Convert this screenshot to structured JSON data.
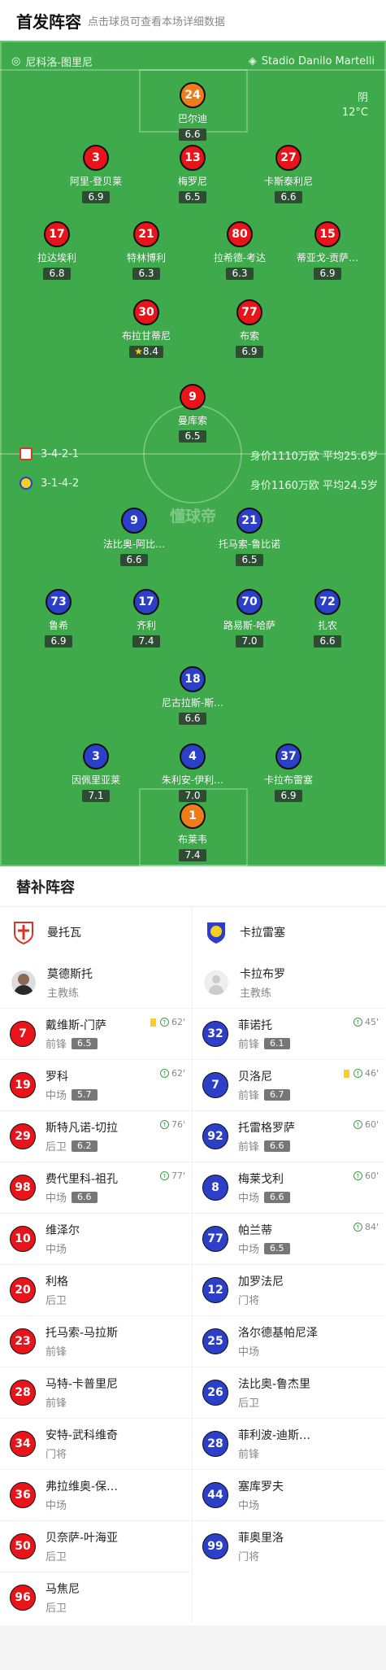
{
  "header": {
    "title": "首发阵容",
    "subtitle": "点击球员可查看本场详细数据"
  },
  "pitch": {
    "home_team": "尼科洛-图里尼",
    "stadium": "Stadio Danilo Martelli",
    "weather": "阴",
    "temperature": "12°C",
    "watermark": "懂球帝",
    "home_formation": "3-4-2-1",
    "home_value": "身价1110万欧 平均25.6岁",
    "away_formation": "3-1-4-2",
    "away_value": "身价1160万欧 平均24.5岁"
  },
  "home_players": [
    {
      "num": "24",
      "name": "巴尔迪",
      "rating": "6.6",
      "color": "orange"
    },
    {
      "num": "3",
      "name": "阿里-登贝莱",
      "rating": "6.9",
      "color": "red"
    },
    {
      "num": "13",
      "name": "梅罗尼",
      "rating": "6.5",
      "color": "red",
      "yellow": true
    },
    {
      "num": "27",
      "name": "卡斯泰利尼",
      "rating": "6.6",
      "color": "red"
    },
    {
      "num": "17",
      "name": "拉达埃利",
      "rating": "6.8",
      "color": "red",
      "sub": "76'"
    },
    {
      "num": "21",
      "name": "特林博利",
      "rating": "6.3",
      "color": "red"
    },
    {
      "num": "80",
      "name": "拉希德-考达",
      "rating": "6.3",
      "color": "red",
      "yellow": true
    },
    {
      "num": "15",
      "name": "蒂亚戈-贡萨…",
      "rating": "6.9",
      "color": "red"
    },
    {
      "num": "30",
      "name": "布拉甘蒂尼",
      "rating": "8.4",
      "color": "red",
      "sub": "62'",
      "goal": true,
      "star": true
    },
    {
      "num": "77",
      "name": "布索",
      "rating": "6.9",
      "color": "red",
      "sub": "77'"
    },
    {
      "num": "9",
      "name": "曼库索",
      "rating": "6.5",
      "color": "red",
      "sub": "62'",
      "captain": true
    }
  ],
  "away_players": [
    {
      "num": "9",
      "name": "法比奥-阿比…",
      "rating": "6.6",
      "color": "blue",
      "sub": "60'"
    },
    {
      "num": "21",
      "name": "托马索-鲁比诺",
      "rating": "6.5",
      "color": "blue",
      "sub": "60'"
    },
    {
      "num": "73",
      "name": "鲁希",
      "rating": "6.9",
      "color": "blue",
      "sub": "46'"
    },
    {
      "num": "17",
      "name": "齐利",
      "rating": "7.4",
      "color": "blue"
    },
    {
      "num": "70",
      "name": "路易斯-哈萨",
      "rating": "7.0",
      "color": "blue",
      "sub": "84'",
      "yellow": true,
      "goal": true
    },
    {
      "num": "72",
      "name": "扎农",
      "rating": "6.6",
      "color": "blue",
      "yellow": true,
      "goal": true
    },
    {
      "num": "18",
      "name": "尼古拉斯-斯…",
      "rating": "6.6",
      "color": "blue",
      "sub": "45'"
    },
    {
      "num": "3",
      "name": "因佩里亚莱",
      "rating": "7.1",
      "color": "blue",
      "captain": true
    },
    {
      "num": "4",
      "name": "朱利安-伊利…",
      "rating": "7.0",
      "color": "blue",
      "yellow": true
    },
    {
      "num": "37",
      "name": "卡拉布雷塞",
      "rating": "6.9",
      "color": "blue"
    },
    {
      "num": "1",
      "name": "布莱韦",
      "rating": "7.4",
      "color": "orange"
    }
  ],
  "bench": {
    "title": "替补阵容",
    "home": {
      "team": "曼托瓦",
      "coach": "莫德斯托",
      "coach_role": "主教练",
      "players": [
        {
          "num": "7",
          "name": "戴维斯-门萨",
          "pos": "前锋",
          "rating": "6.5",
          "sub": "62'",
          "yellow": true
        },
        {
          "num": "19",
          "name": "罗科",
          "pos": "中场",
          "rating": "5.7",
          "sub": "62'"
        },
        {
          "num": "29",
          "name": "斯特凡诺-切拉",
          "pos": "后卫",
          "rating": "6.2",
          "sub": "76'"
        },
        {
          "num": "98",
          "name": "费代里科-祖孔",
          "pos": "中场",
          "rating": "6.6",
          "sub": "77'"
        },
        {
          "num": "10",
          "name": "维泽尔",
          "pos": "中场"
        },
        {
          "num": "20",
          "name": "利格",
          "pos": "后卫"
        },
        {
          "num": "23",
          "name": "托马索-马拉斯",
          "pos": "前锋"
        },
        {
          "num": "28",
          "name": "马特-卡普里尼",
          "pos": "前锋"
        },
        {
          "num": "34",
          "name": "安特-武科维奇",
          "pos": "门将"
        },
        {
          "num": "36",
          "name": "弗拉维奥-保…",
          "pos": "中场"
        },
        {
          "num": "50",
          "name": "贝奈萨-叶海亚",
          "pos": "后卫"
        },
        {
          "num": "96",
          "name": "马焦尼",
          "pos": "后卫"
        }
      ]
    },
    "away": {
      "team": "卡拉雷塞",
      "coach": "卡拉布罗",
      "coach_role": "主教练",
      "players": [
        {
          "num": "32",
          "name": "菲诺托",
          "pos": "前锋",
          "rating": "6.1",
          "sub": "45'"
        },
        {
          "num": "7",
          "name": "贝洛尼",
          "pos": "前锋",
          "rating": "6.7",
          "sub": "46'",
          "yellow": true
        },
        {
          "num": "92",
          "name": "托雷格罗萨",
          "pos": "前锋",
          "rating": "6.6",
          "sub": "60'"
        },
        {
          "num": "8",
          "name": "梅莱戈利",
          "pos": "中场",
          "rating": "6.6",
          "sub": "60'"
        },
        {
          "num": "77",
          "name": "帕兰蒂",
          "pos": "中场",
          "rating": "6.5",
          "sub": "84'"
        },
        {
          "num": "12",
          "name": "加罗法尼",
          "pos": "门将"
        },
        {
          "num": "25",
          "name": "洛尔德基帕尼泽",
          "pos": "中场"
        },
        {
          "num": "26",
          "name": "法比奥-鲁杰里",
          "pos": "后卫"
        },
        {
          "num": "28",
          "name": "菲利波-迪斯…",
          "pos": "前锋"
        },
        {
          "num": "44",
          "name": "塞库罗夫",
          "pos": "中场"
        },
        {
          "num": "99",
          "name": "菲奥里洛",
          "pos": "门将"
        }
      ]
    }
  }
}
